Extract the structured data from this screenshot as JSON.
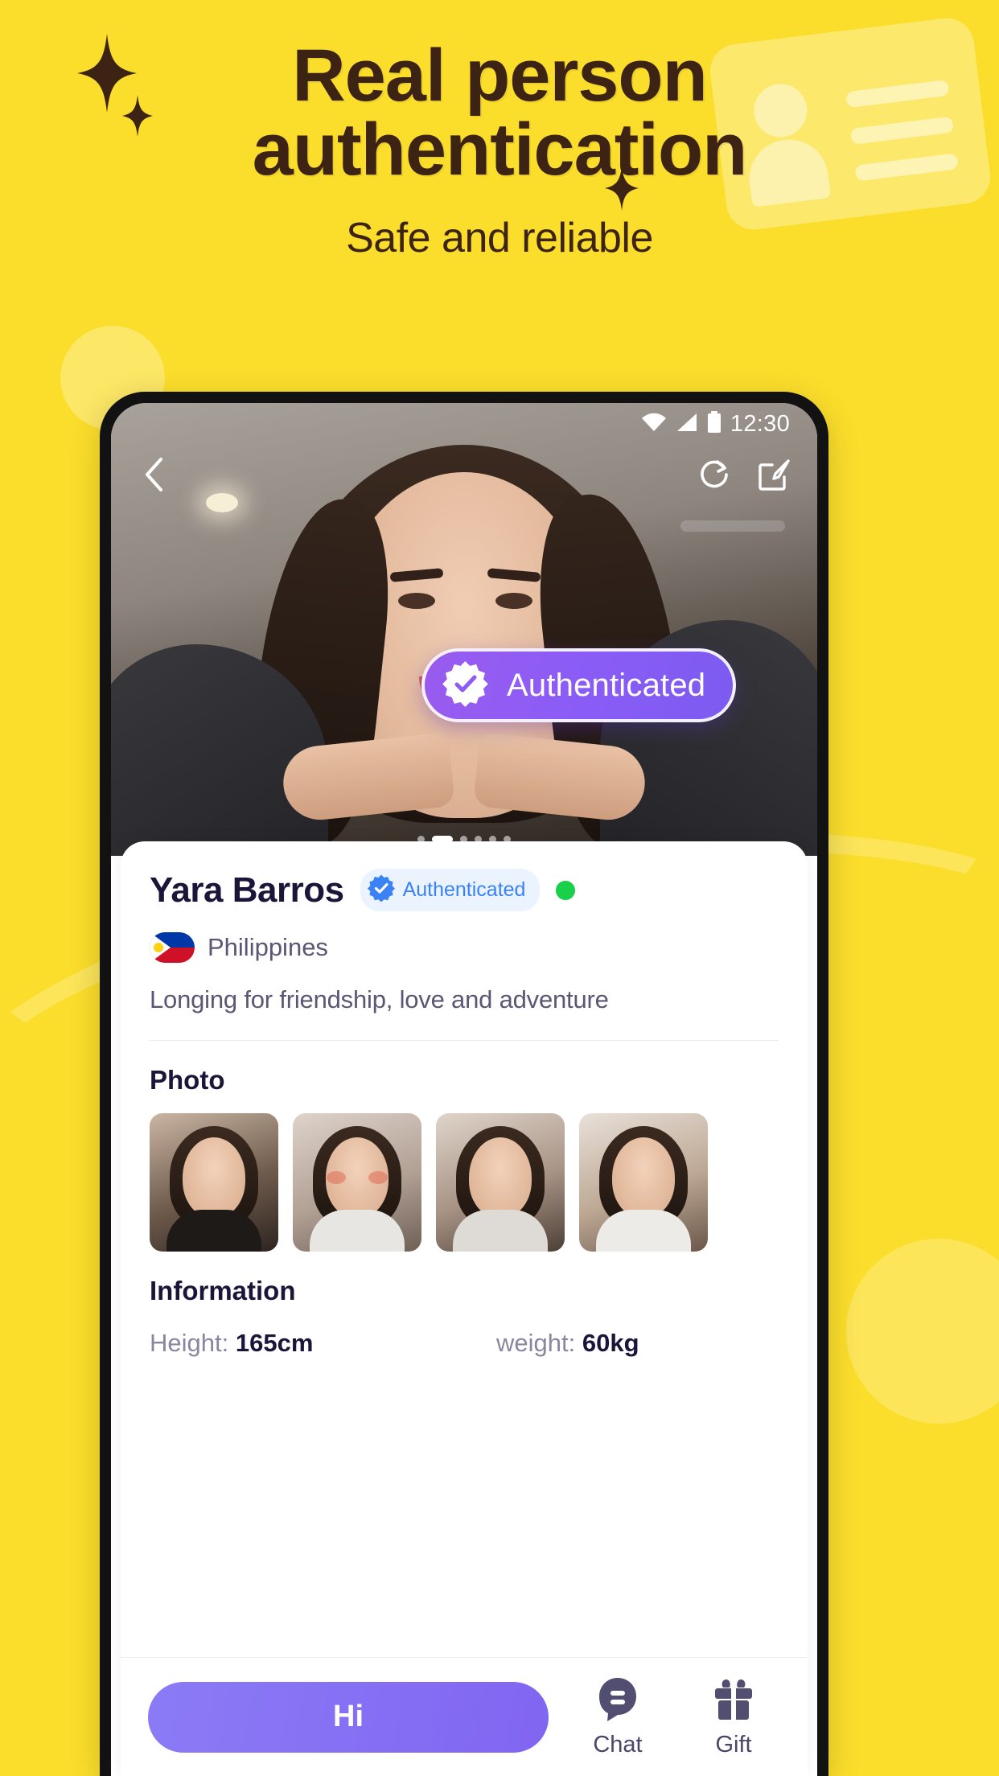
{
  "header": {
    "title_line1": "Real person",
    "title_line2": "authentication",
    "subtitle": "Safe and reliable",
    "title_color": "#3D2314",
    "background_color": "#FBDE2B"
  },
  "phone": {
    "statusbar": {
      "time": "12:30",
      "wifi_icon": "wifi-icon",
      "signal_icon": "cellular-signal-icon",
      "battery_icon": "battery-icon"
    },
    "topnav": {
      "back_icon": "chevron-left-icon",
      "refresh_icon": "refresh-icon",
      "edit_icon": "edit-icon"
    },
    "carousel": {
      "total_dots": 6,
      "active_index": 1
    },
    "floating_badge": {
      "label": "Authenticated",
      "icon": "verified-starburst-icon",
      "color": "#8B5CF6"
    }
  },
  "profile": {
    "name": "Yara Barros",
    "auth_chip": {
      "label": "Authenticated",
      "icon": "verified-badge-icon",
      "color": "#3B82F6"
    },
    "online_status": "online",
    "online_color": "#19D04B",
    "country": "Philippines",
    "country_flag_icon": "philippines-flag-icon",
    "bio": "Longing for friendship, love and adventure",
    "photo_section_title": "Photo",
    "photos": [
      {
        "alt": "photo-1"
      },
      {
        "alt": "photo-2"
      },
      {
        "alt": "photo-3"
      },
      {
        "alt": "photo-4"
      }
    ],
    "information_section_title": "Information",
    "information": [
      {
        "label": "Height:",
        "value": "165cm"
      },
      {
        "label": "weight:",
        "value": "60kg"
      }
    ]
  },
  "actions": {
    "primary_label": "Hi",
    "primary_color": "#8165F2",
    "chat": {
      "label": "Chat",
      "icon": "chat-bubble-icon"
    },
    "gift": {
      "label": "Gift",
      "icon": "gift-icon"
    }
  }
}
